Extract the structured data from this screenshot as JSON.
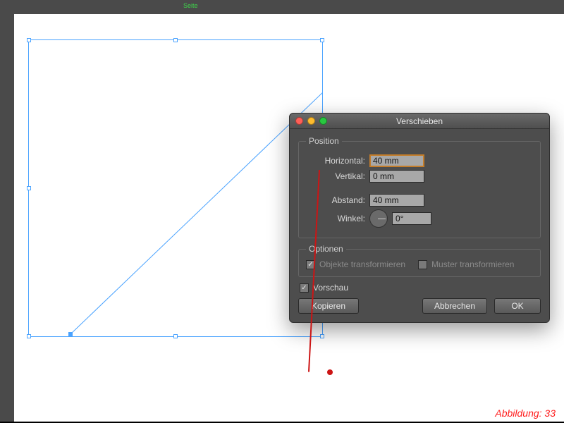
{
  "canvas": {
    "page_label": "Seite"
  },
  "dialog": {
    "title": "Verschieben",
    "position_legend": "Position",
    "horizontal_label": "Horizontal:",
    "horizontal_value": "40 mm",
    "vertical_label": "Vertikal:",
    "vertical_value": "0 mm",
    "distance_label": "Abstand:",
    "distance_value": "40 mm",
    "angle_label": "Winkel:",
    "angle_value": "0°",
    "options_legend": "Optionen",
    "transform_objects": "Objekte transformieren",
    "transform_patterns": "Muster transformieren",
    "preview": "Vorschau",
    "copy_btn": "Kopieren",
    "cancel_btn": "Abbrechen",
    "ok_btn": "OK"
  },
  "annotation": {
    "caption": "Abbildung: 33"
  }
}
